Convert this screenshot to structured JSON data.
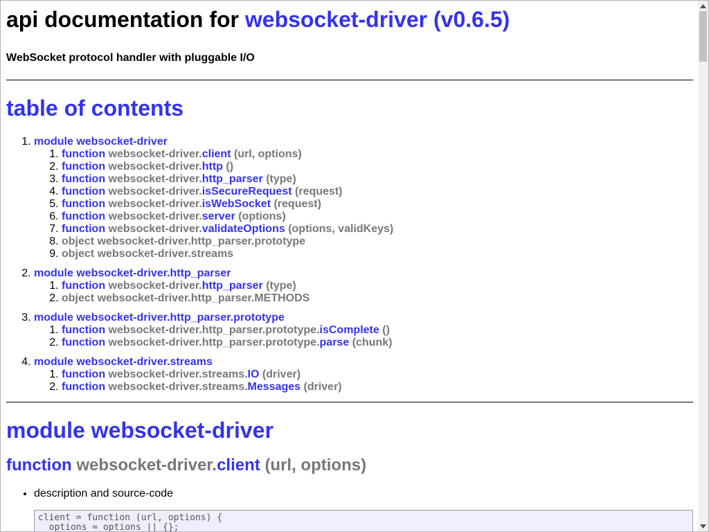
{
  "header": {
    "title_prefix": "api documentation for ",
    "package_name": "websocket-driver (v0.6.5)",
    "description": "WebSocket protocol handler with pluggable I/O"
  },
  "toc": {
    "title": "table of contents",
    "modules": [
      {
        "label": "module websocket-driver",
        "items": [
          {
            "kind": "function",
            "prefix": "websocket-driver.",
            "name": "client",
            "args": "(url, options)"
          },
          {
            "kind": "function",
            "prefix": "websocket-driver.",
            "name": "http",
            "args": "()"
          },
          {
            "kind": "function",
            "prefix": "websocket-driver.",
            "name": "http_parser",
            "args": "(type)"
          },
          {
            "kind": "function",
            "prefix": "websocket-driver.",
            "name": "isSecureRequest",
            "args": "(request)"
          },
          {
            "kind": "function",
            "prefix": "websocket-driver.",
            "name": "isWebSocket",
            "args": "(request)"
          },
          {
            "kind": "function",
            "prefix": "websocket-driver.",
            "name": "server",
            "args": "(options)"
          },
          {
            "kind": "function",
            "prefix": "websocket-driver.",
            "name": "validateOptions",
            "args": "(options, validKeys)"
          },
          {
            "kind": "object",
            "text": "object websocket-driver.http_parser.prototype"
          },
          {
            "kind": "object",
            "text": "object websocket-driver.streams"
          }
        ]
      },
      {
        "label": "module websocket-driver.http_parser",
        "items": [
          {
            "kind": "function",
            "prefix": "websocket-driver.",
            "name": "http_parser",
            "args": "(type)"
          },
          {
            "kind": "object",
            "text": "object websocket-driver.http_parser.METHODS"
          }
        ]
      },
      {
        "label": "module websocket-driver.http_parser.prototype",
        "items": [
          {
            "kind": "function",
            "prefix": "websocket-driver.http_parser.prototype.",
            "name": "isComplete",
            "args": "()"
          },
          {
            "kind": "function",
            "prefix": "websocket-driver.http_parser.prototype.",
            "name": "parse",
            "args": "(chunk)"
          }
        ]
      },
      {
        "label": "module websocket-driver.streams",
        "items": [
          {
            "kind": "function",
            "prefix": "websocket-driver.streams.",
            "name": "IO",
            "args": "(driver)"
          },
          {
            "kind": "function",
            "prefix": "websocket-driver.streams.",
            "name": "Messages",
            "args": "(driver)"
          }
        ]
      }
    ]
  },
  "section": {
    "module_heading": "module websocket-driver",
    "function_keyword": "function",
    "function_prefix": "websocket-driver.",
    "function_name": "client",
    "function_args": "(url, options)",
    "bullet_label": "description and source-code",
    "code": "client = function (url, options) {\n  options = options || {};"
  },
  "colors": {
    "link": "#3333ee",
    "muted": "#777777",
    "code_bg": "#eeeeff"
  }
}
